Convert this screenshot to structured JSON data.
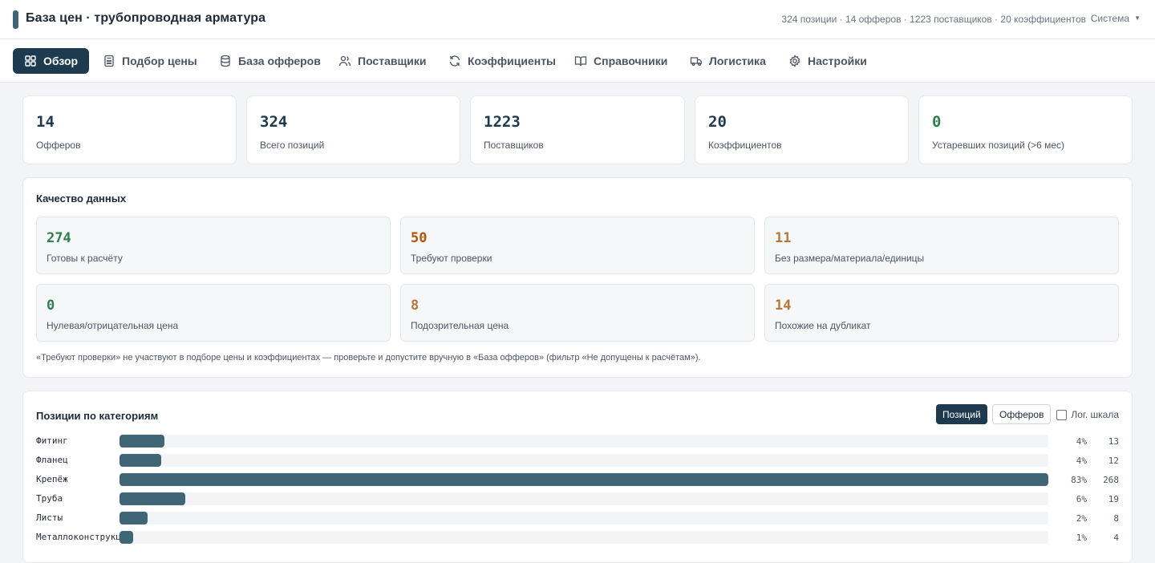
{
  "header": {
    "title": "База цен · трубопроводная арматура",
    "stats": "324 позиции · 14 офферов · 1223 поставщиков · 20 коэффициентов",
    "system_menu": "Система"
  },
  "nav": {
    "tabs": [
      {
        "label": "Обзор",
        "icon": "grid-icon"
      },
      {
        "label": "Подбор цены",
        "icon": "calculator-icon"
      },
      {
        "label": "База офферов",
        "icon": "database-icon"
      },
      {
        "label": "Поставщики",
        "icon": "users-icon"
      },
      {
        "label": "Коэффициенты",
        "icon": "refresh-icon"
      },
      {
        "label": "Справочники",
        "icon": "book-icon"
      },
      {
        "label": "Логистика",
        "icon": "truck-icon"
      },
      {
        "label": "Настройки",
        "icon": "gear-icon"
      }
    ],
    "active_index": 0
  },
  "kpis": [
    {
      "value": "14",
      "label": "Офферов"
    },
    {
      "value": "324",
      "label": "Всего позиций"
    },
    {
      "value": "1223",
      "label": "Поставщиков"
    },
    {
      "value": "20",
      "label": "Коэффициентов"
    },
    {
      "value": "0",
      "label": "Устаревших позиций (>6 мес)"
    }
  ],
  "quality": {
    "title": "Качество данных",
    "items": [
      {
        "value": "274",
        "label": "Готовы к расчёту",
        "color": "#2e7d4f"
      },
      {
        "value": "50",
        "label": "Требуют проверки",
        "color": "#b45309"
      },
      {
        "value": "11",
        "label": "Без размера/материала/единицы",
        "color": "#b7793a"
      },
      {
        "value": "0",
        "label": "Нулевая/отрицательная цена",
        "color": "#2e7d4f"
      },
      {
        "value": "8",
        "label": "Подозрительная цена",
        "color": "#b7793a"
      },
      {
        "value": "14",
        "label": "Похожие на дубликат",
        "color": "#b7793a"
      }
    ],
    "note": "«Требуют проверки» не участвуют в подборе цены и коэффициентах — проверьте и допустите вручную в «База офферов» (фильтр «Не допущены к расчётам»)."
  },
  "categories": {
    "title": "Позиции по категориям",
    "toggle_positions": "Позиций",
    "toggle_offers": "Офферов",
    "log_scale_label": "Лог. шкала",
    "log_scale_checked": false,
    "colors": {
      "bar": "#3f6577",
      "track": "#f3f4f6"
    },
    "rows": [
      {
        "name": "Фитинг",
        "percent": "4%",
        "count": 13
      },
      {
        "name": "Фланец",
        "percent": "4%",
        "count": 12
      },
      {
        "name": "Крепёж",
        "percent": "83%",
        "count": 268
      },
      {
        "name": "Труба",
        "percent": "6%",
        "count": 19
      },
      {
        "name": "Листы",
        "percent": "2%",
        "count": 8
      },
      {
        "name": "Металлоконструкции",
        "percent": "1%",
        "count": 4
      }
    ]
  }
}
